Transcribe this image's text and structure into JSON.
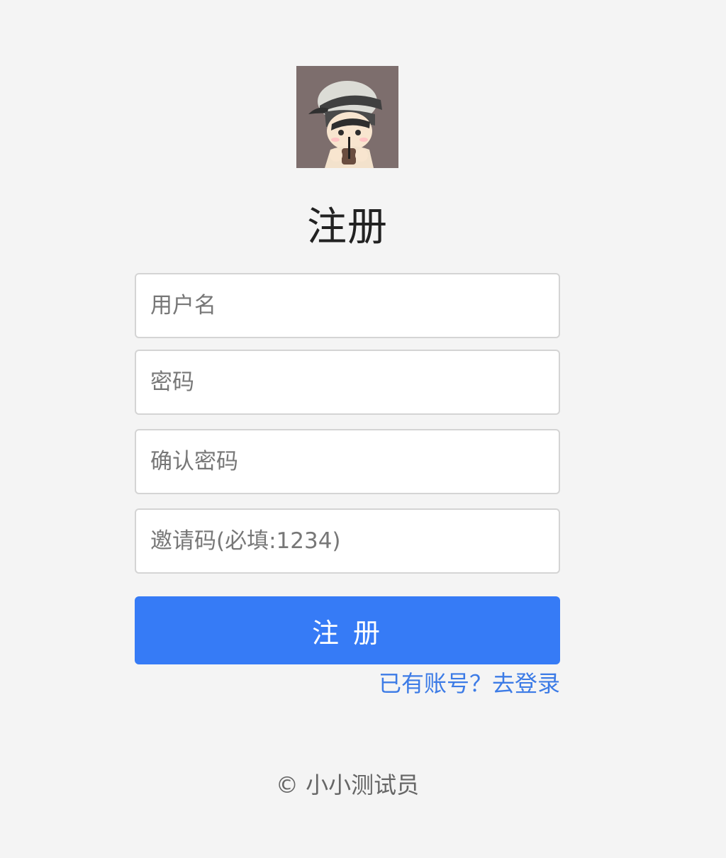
{
  "header": {
    "title": "注册"
  },
  "form": {
    "username_placeholder": "用户名",
    "password_placeholder": "密码",
    "confirm_password_placeholder": "确认密码",
    "invite_code_placeholder": "邀请码(必填:1234)",
    "submit_label": "注 册",
    "login_link_label": "已有账号？去登录"
  },
  "footer": {
    "text": "© 小小测试员"
  },
  "colors": {
    "background": "#f4f4f4",
    "primary": "#367bf6",
    "link": "#3c7be6"
  },
  "icons": {
    "avatar": "cartoon-avatar-icon"
  }
}
